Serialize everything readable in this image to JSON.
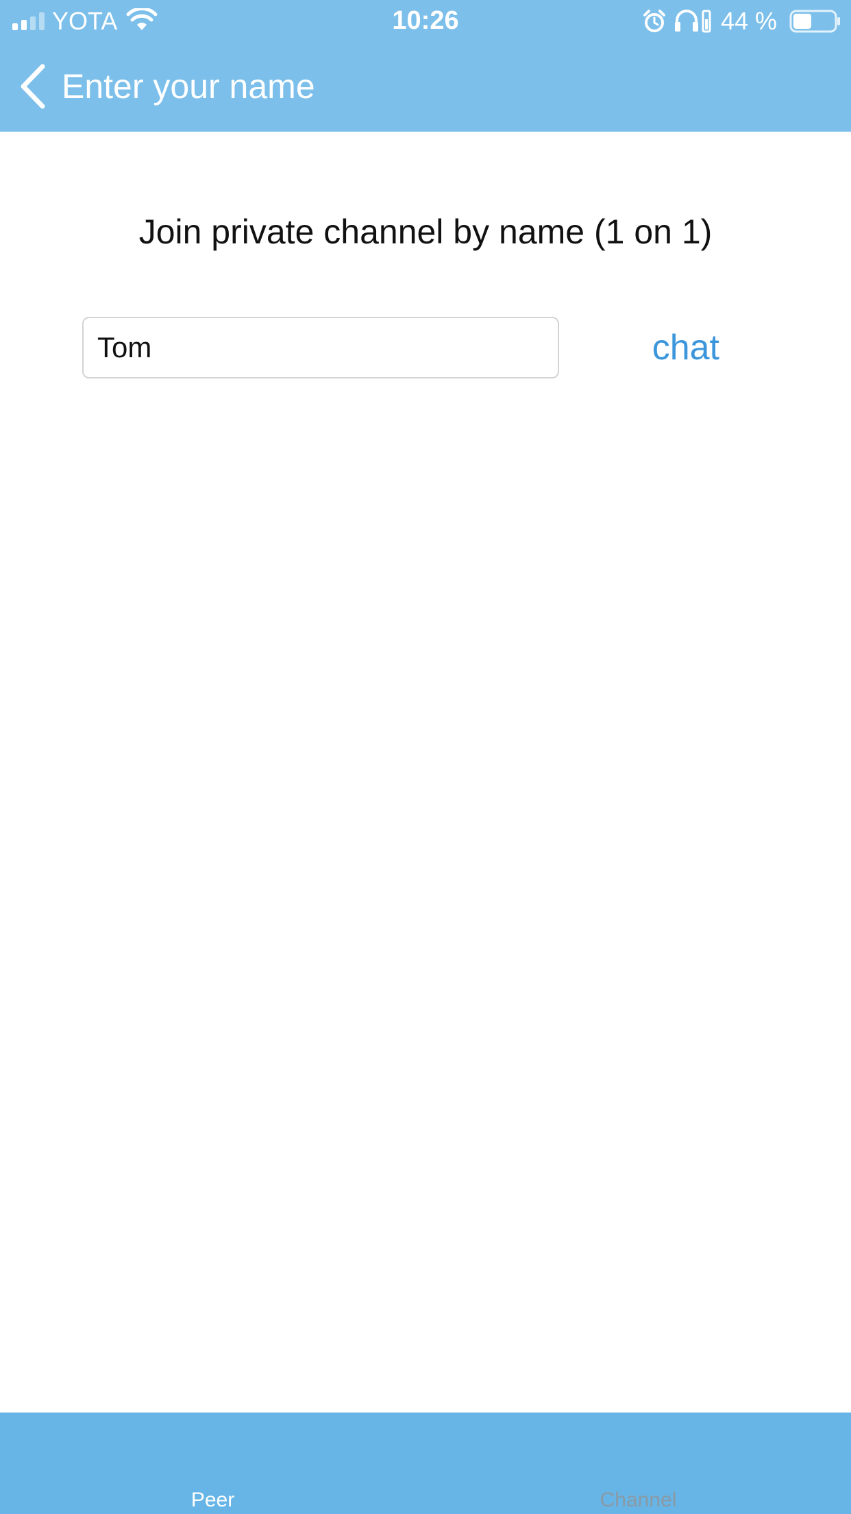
{
  "status_bar": {
    "carrier": "YOTA",
    "time": "10:26",
    "battery_percent": "44 %",
    "battery_level": 0.44,
    "icons": [
      "signal-icon",
      "wifi-icon",
      "alarm-icon",
      "headphones-icon",
      "battery-icon"
    ]
  },
  "nav": {
    "back_icon": "chevron-left-icon",
    "title": "Enter your name"
  },
  "main": {
    "heading": "Join private channel by name (1 on 1)",
    "name_input_value": "Tom",
    "chat_button_label": "chat"
  },
  "tabs": [
    {
      "label": "Peer",
      "selected": true
    },
    {
      "label": "Channel",
      "selected": false
    }
  ],
  "colors": {
    "header_bg": "#7bbfea",
    "tabbar_bg": "#67b5e6",
    "accent": "#3b96dc",
    "inactive_tab": "#8a9aa5"
  }
}
